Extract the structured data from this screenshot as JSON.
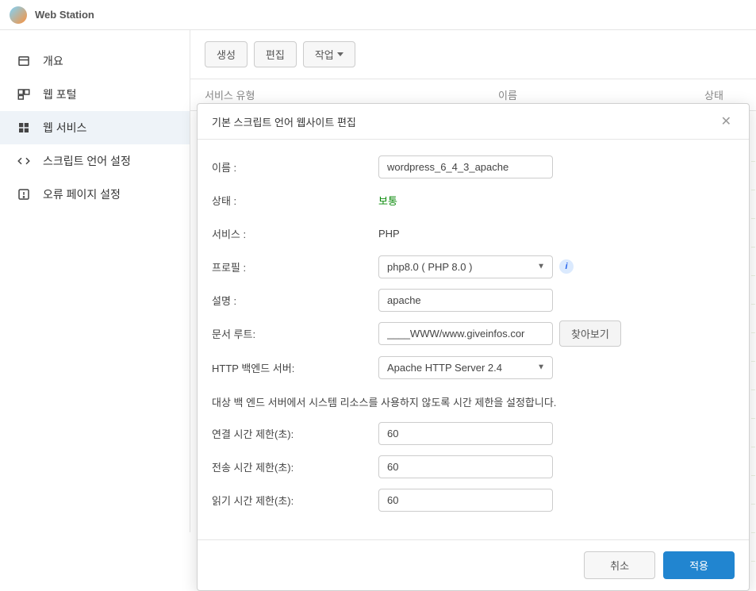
{
  "app_title": "Web Station",
  "sidebar": {
    "items": [
      {
        "label": "개요"
      },
      {
        "label": "웹 포털"
      },
      {
        "label": "웹 서비스"
      },
      {
        "label": "스크립트 언어 설정"
      },
      {
        "label": "오류 페이지 설정"
      }
    ]
  },
  "toolbar": {
    "create": "생성",
    "edit": "편집",
    "action": "작업"
  },
  "table": {
    "col_type": "서비스 유형",
    "col_name": "이름",
    "col_status": "상태"
  },
  "modal": {
    "title": "기본 스크립트 언어 웹사이트 편집",
    "labels": {
      "name": "이름 :",
      "status": "상태 :",
      "service": "서비스 :",
      "profile": "프로필 :",
      "description": "설명 :",
      "docroot": "문서 루트:",
      "backend": "HTTP 백엔드 서버:",
      "connect_timeout": "연결 시간 제한(초):",
      "send_timeout": "전송 시간 제한(초):",
      "read_timeout": "읽기 시간 제한(초):"
    },
    "values": {
      "name": "wordpress_6_4_3_apache",
      "status": "보통",
      "service": "PHP",
      "profile": "php8.0 ( PHP 8.0 )",
      "description": "apache",
      "docroot": "____WWW/www.giveinfos.cor",
      "backend": "Apache HTTP Server 2.4",
      "connect_timeout": "60",
      "send_timeout": "60",
      "read_timeout": "60"
    },
    "help_text": "대상 백 엔드 서버에서 시스템 리소스를 사용하지 않도록 시간 제한을 설정합니다.",
    "browse": "찾아보기",
    "cancel": "취소",
    "apply": "적용"
  }
}
